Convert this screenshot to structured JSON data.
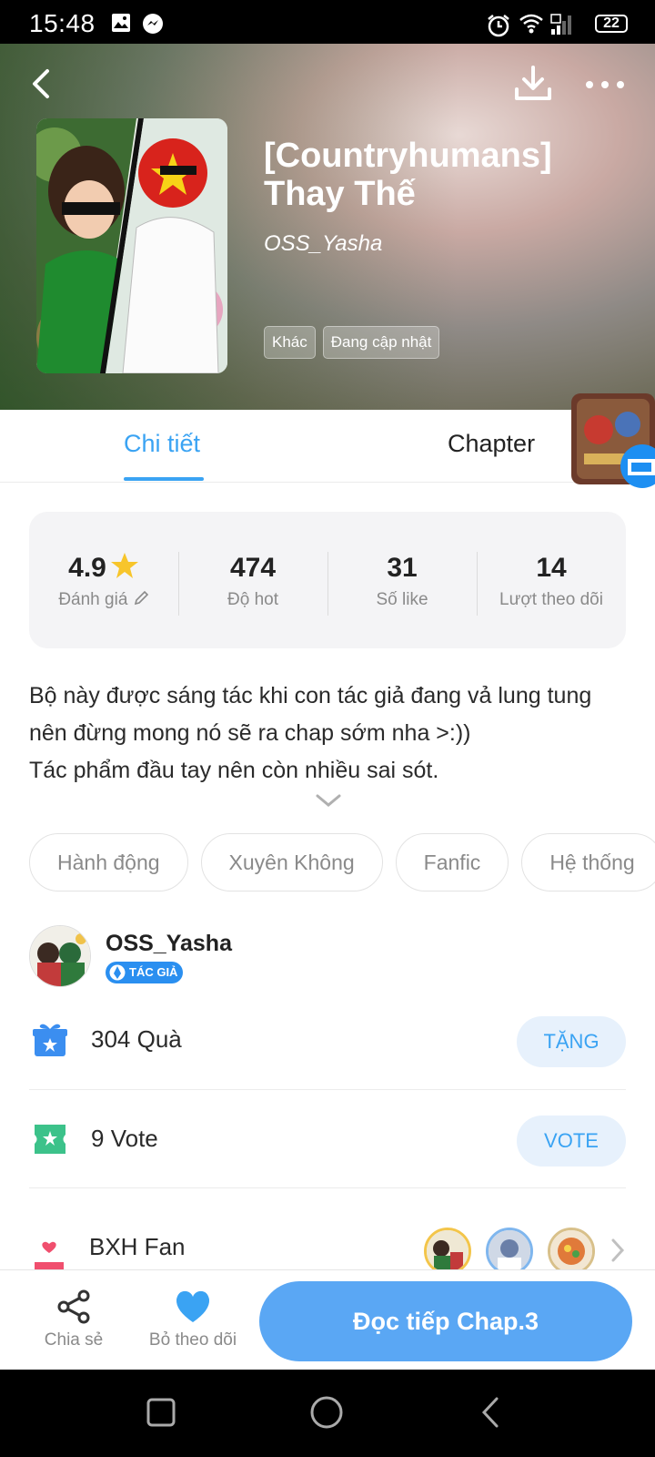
{
  "status_bar": {
    "time": "15:48",
    "battery": "22"
  },
  "header": {
    "title": "[Countryhumans] Thay Thế",
    "author": "OSS_Yasha",
    "tags": [
      "Khác",
      "Đang cập nhật"
    ]
  },
  "tabs": [
    {
      "label": "Chi tiết",
      "active": true
    },
    {
      "label": "Chapter",
      "active": false
    }
  ],
  "stats": [
    {
      "value": "4.9",
      "label": "Đánh giá"
    },
    {
      "value": "474",
      "label": "Độ hot"
    },
    {
      "value": "31",
      "label": "Số like"
    },
    {
      "value": "14",
      "label": "Lượt theo dõi"
    }
  ],
  "description": {
    "line1": "Bộ này được sáng tác khi con tác giả đang vả lung tung nên đừng mong nó sẽ ra chap sớm nha >:))",
    "line2": "Tác phẩm đầu tay nên còn nhiều sai sót."
  },
  "genres": [
    "Hành động",
    "Xuyên Không",
    "Fanfic",
    "Hệ thống"
  ],
  "author_section": {
    "name": "OSS_Yasha",
    "badge": "TÁC GIẢ"
  },
  "gifts": {
    "count": "304",
    "label": "Quà",
    "button": "TẶNG"
  },
  "votes": {
    "count": "9",
    "label": "Vote",
    "button": "VOTE"
  },
  "fan_ranking": {
    "title": "BXH Fan"
  },
  "actions": {
    "share": "Chia sẻ",
    "unfollow": "Bỏ theo dõi",
    "continue": "Đọc tiếp Chap.3"
  },
  "colors": {
    "accent": "#3aa3f3",
    "button_fill": "#5aa7f4",
    "badge": "#2a8ff0"
  }
}
